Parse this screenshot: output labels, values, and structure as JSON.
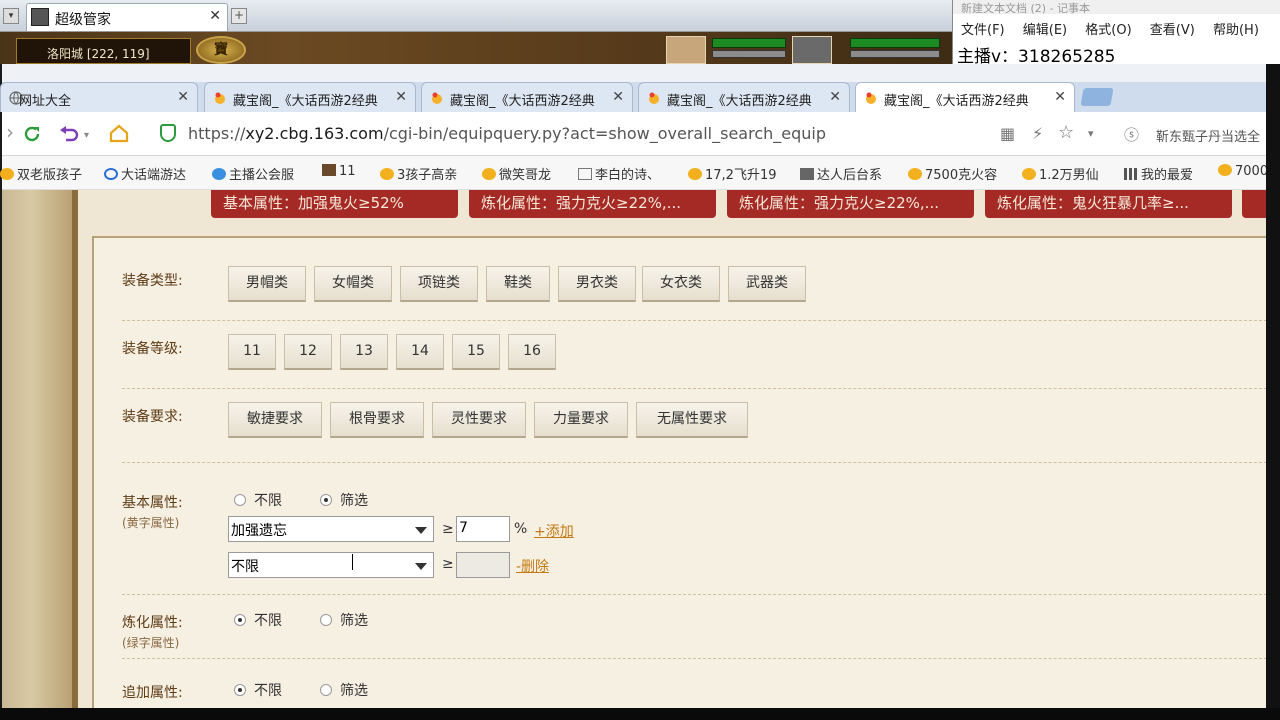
{
  "game": {
    "tab_title": "超级管家",
    "location": "洛阳城 [222, 119]",
    "badge": "寶",
    "newtab": "+",
    "menu_btn": "▾",
    "close": "✕"
  },
  "notepad": {
    "title": "新建文本文档 (2) - 记事本",
    "menu": [
      "文件(F)",
      "编辑(E)",
      "格式(O)",
      "查看(V)",
      "帮助(H)"
    ],
    "text": "主播v：318265285"
  },
  "browser": {
    "tabs": [
      {
        "label": "网址大全",
        "active": false
      },
      {
        "label": "藏宝阁_《大话西游2经典",
        "active": false
      },
      {
        "label": "藏宝阁_《大话西游2经典",
        "active": false
      },
      {
        "label": "藏宝阁_《大话西游2经典",
        "active": false
      },
      {
        "label": "藏宝阁_《大话西游2经典",
        "active": true
      }
    ],
    "tab_close": "✕",
    "url_prefix": "https://",
    "url_host": "xy2.cbg.163.com",
    "url_path": "/cgi-bin/equipquery.py?act=show_overall_search_equip",
    "extension_text": "靳东甄子丹当选全",
    "bookmarks": [
      "双老版孩子",
      "大话端游达",
      "主播公会服",
      "11",
      "3孩子高亲",
      "微笑哥龙",
      "李白的诗、",
      "17,2飞升19",
      "达人后台系",
      "7500克火容",
      "1.2万男仙",
      "我的最爱",
      "7000"
    ],
    "accent": "#a52a26"
  },
  "search": {
    "tags": [
      "基本属性：加强鬼火≥52%",
      "炼化属性：强力克火≥22%,...",
      "炼化属性：强力克火≥22%,...",
      "炼化属性：鬼火狂暴几率≥..."
    ],
    "equip_type": {
      "label": "装备类型:",
      "options": [
        "男帽类",
        "女帽类",
        "项链类",
        "鞋类",
        "男衣类",
        "女衣类",
        "武器类"
      ]
    },
    "equip_level": {
      "label": "装备等级:",
      "options": [
        "11",
        "12",
        "13",
        "14",
        "15",
        "16"
      ]
    },
    "equip_req": {
      "label": "装备要求:",
      "options": [
        "敏捷要求",
        "根骨要求",
        "灵性要求",
        "力量要求",
        "无属性要求"
      ]
    },
    "basic_attr": {
      "label": "基本属性:",
      "sublabel": "(黄字属性)",
      "radio_unlimited": "不限",
      "radio_filter": "筛选",
      "selected": "filter",
      "row1_select": "加强遗忘",
      "row1_value": "7",
      "row1_unit": "%",
      "add_link": "+添加",
      "row2_select": "不限",
      "row2_value": "",
      "remove_link": "-删除",
      "ge": "≥"
    },
    "refine_attr": {
      "label": "炼化属性:",
      "sublabel": "(绿字属性)",
      "radio_unlimited": "不限",
      "radio_filter": "筛选",
      "selected": "unlimited"
    },
    "extra_attr": {
      "label": "追加属性:",
      "radio_unlimited": "不限",
      "radio_filter": "筛选",
      "selected": "unlimited"
    }
  }
}
